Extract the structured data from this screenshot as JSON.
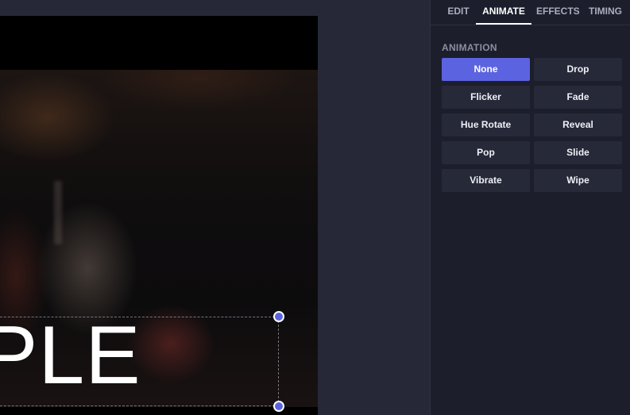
{
  "canvas": {
    "text_layer": "PLE"
  },
  "panel": {
    "tabs": [
      {
        "label": "EDIT",
        "active": false
      },
      {
        "label": "ANIMATE",
        "active": true
      },
      {
        "label": "EFFECTS",
        "active": false
      },
      {
        "label": "TIMING",
        "active": false
      }
    ],
    "section_label": "ANIMATION",
    "animations": [
      {
        "label": "None",
        "selected": true
      },
      {
        "label": "Drop",
        "selected": false
      },
      {
        "label": "Flicker",
        "selected": false
      },
      {
        "label": "Fade",
        "selected": false
      },
      {
        "label": "Hue Rotate",
        "selected": false
      },
      {
        "label": "Reveal",
        "selected": false
      },
      {
        "label": "Pop",
        "selected": false
      },
      {
        "label": "Slide",
        "selected": false
      },
      {
        "label": "Vibrate",
        "selected": false
      },
      {
        "label": "Wipe",
        "selected": false
      }
    ]
  },
  "colors": {
    "accent": "#5b63e0",
    "panel_bg": "#1c1e2c",
    "button_bg": "#262938",
    "workspace_bg": "#262837"
  }
}
